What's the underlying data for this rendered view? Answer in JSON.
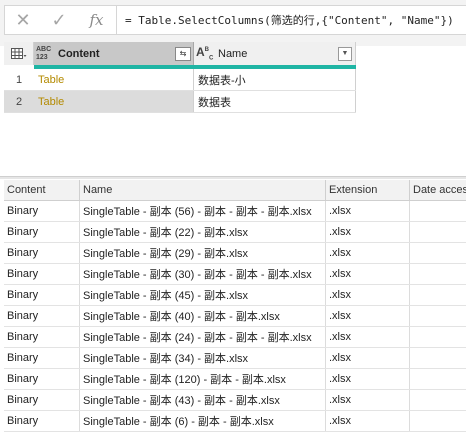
{
  "formula_bar": {
    "cancel_icon": "close-icon",
    "confirm_icon": "check-icon",
    "fx_label": "fx",
    "formula": "= Table.SelectColumns(筛选的行,{\"Content\", \"Name\"})"
  },
  "preview": {
    "columns": [
      {
        "type_label": "ABC\n123",
        "title": "Content"
      },
      {
        "type_label": "ABC",
        "title": "Name"
      }
    ],
    "rows": [
      {
        "num": "1",
        "content": "Table",
        "name": "数据表-小"
      },
      {
        "num": "2",
        "content": "Table",
        "name": "数据表"
      }
    ]
  },
  "files": {
    "headers": [
      "Content",
      "Name",
      "Extension",
      "Date acces"
    ],
    "rows": [
      {
        "content": "Binary",
        "name": "SingleTable - 副本 (56) - 副本 - 副本 - 副本.xlsx",
        "ext": ".xlsx",
        "date": ""
      },
      {
        "content": "Binary",
        "name": "SingleTable - 副本 (22) - 副本.xlsx",
        "ext": ".xlsx",
        "date": ""
      },
      {
        "content": "Binary",
        "name": "SingleTable - 副本 (29) - 副本.xlsx",
        "ext": ".xlsx",
        "date": ""
      },
      {
        "content": "Binary",
        "name": "SingleTable - 副本 (30) - 副本 - 副本 - 副本.xlsx",
        "ext": ".xlsx",
        "date": ""
      },
      {
        "content": "Binary",
        "name": "SingleTable - 副本 (45) - 副本.xlsx",
        "ext": ".xlsx",
        "date": ""
      },
      {
        "content": "Binary",
        "name": "SingleTable - 副本 (40) - 副本 - 副本.xlsx",
        "ext": ".xlsx",
        "date": ""
      },
      {
        "content": "Binary",
        "name": "SingleTable - 副本 (24) - 副本 - 副本 - 副本.xlsx",
        "ext": ".xlsx",
        "date": ""
      },
      {
        "content": "Binary",
        "name": "SingleTable - 副本 (34) - 副本.xlsx",
        "ext": ".xlsx",
        "date": ""
      },
      {
        "content": "Binary",
        "name": "SingleTable - 副本 (120) - 副本 - 副本.xlsx",
        "ext": ".xlsx",
        "date": ""
      },
      {
        "content": "Binary",
        "name": "SingleTable - 副本 (43) - 副本 - 副本.xlsx",
        "ext": ".xlsx",
        "date": ""
      },
      {
        "content": "Binary",
        "name": "SingleTable - 副本 (6) - 副本 - 副本.xlsx",
        "ext": ".xlsx",
        "date": ""
      }
    ]
  },
  "colors": {
    "quality_bar": "#1fb5a4",
    "table_link": "#b38a00"
  }
}
